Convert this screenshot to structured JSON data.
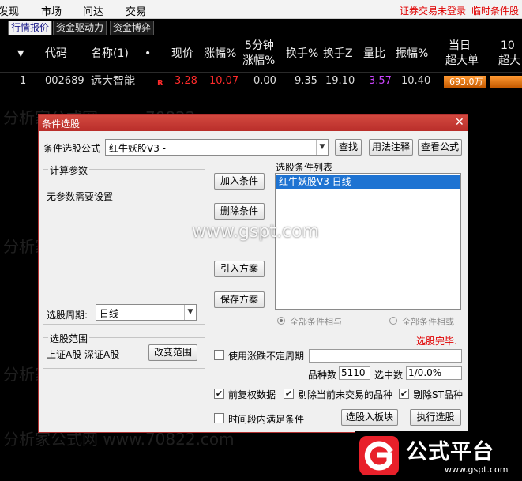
{
  "menu": {
    "items": [
      "发现",
      "市场",
      "问达",
      "交易"
    ],
    "notice_login": "证券交易未登录",
    "notice_condition": "临时条件股"
  },
  "subtabs": [
    "行情报价",
    "资金驱动力",
    "资金博弈"
  ],
  "grid": {
    "headers": {
      "code": "代码",
      "name": "名称(1)",
      "dot": "•",
      "price": "现价",
      "change_pct": "涨幅%",
      "five_min_l1": "5分钟",
      "five_min_l2": "涨幅%",
      "turnover": "换手%",
      "turnover_z": "换手Z",
      "volume_ratio": "量比",
      "amplitude": "振幅%",
      "super_large_l1": "当日",
      "super_large_l2": "超大单",
      "next_col_l1": "10",
      "next_col_l2": "超大"
    },
    "rows": [
      {
        "index": "1",
        "code": "002689",
        "name": "远大智能",
        "flag": "R",
        "price": "3.28",
        "change_pct": "10.07",
        "five_min": "0.00",
        "turnover": "9.35",
        "turnover_z": "19.10",
        "volume_ratio": "3.57",
        "amplitude": "10.40",
        "super_large": "693.0万"
      }
    ]
  },
  "watermark": {
    "text": "分析家公式网 www.70822.com",
    "site": "www.gspt.com"
  },
  "dialog": {
    "title": "条件选股",
    "formula_label": "条件选股公式",
    "formula_value": "红牛妖股V3  -",
    "find_button": "查找",
    "usage_button": "用法注释",
    "view_formula_button": "查看公式",
    "params_group": "计算参数",
    "params_text": "无参数需要设置",
    "add_condition_button": "加入条件",
    "delete_condition_button": "删除条件",
    "import_plan_button": "引入方案",
    "save_plan_button": "保存方案",
    "condition_list_label": "选股条件列表",
    "condition_list_items": [
      "红牛妖股V3  日线"
    ],
    "period_label": "选股周期:",
    "period_value": "日线",
    "radio_and": "全部条件相与",
    "radio_or": "全部条件相或",
    "status": "选股完毕.",
    "range_group": "选股范围",
    "range_text": "上证A股 深证A股",
    "change_range_button": "改变范围",
    "use_variable_period": "使用涨跌不定周期",
    "variety_count_label": "品种数",
    "variety_count": "5110",
    "selected_label": "选中数",
    "selected_value": "1/0.0%",
    "pre_adjust": "前复权数据",
    "exclude_untraded": "剔除当前未交易的品种",
    "exclude_st": "剔除ST品种",
    "time_range": "时间段内满足条件",
    "to_block_button": "选股入板块",
    "execute_button": "执行选股"
  },
  "logo": {
    "text": "公式平台",
    "url": "www.gspt.com"
  },
  "colors": {
    "accent_red": "#c0392b",
    "price_red": "#ff2b2b",
    "ratio_purple": "#cc44ff",
    "selection_blue": "#1e73d2",
    "bar_orange": "#e07a1a"
  }
}
